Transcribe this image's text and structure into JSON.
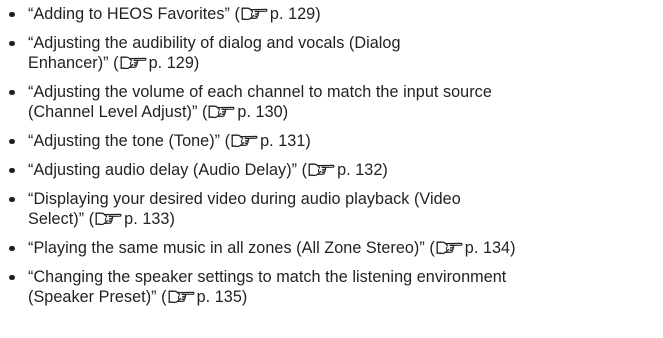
{
  "items": [
    {
      "lines": [
        "“Adding to HEOS Favorites” ("
      ],
      "page": "p. 129",
      "tail": ")"
    },
    {
      "lines": [
        "“Adjusting the audibility of dialog and vocals (Dialog",
        "Enhancer)” ("
      ],
      "page": "p. 129",
      "tail": ")"
    },
    {
      "lines": [
        "“Adjusting the volume of each channel to match the input source",
        "(Channel Level Adjust)” ("
      ],
      "page": "p. 130",
      "tail": ")"
    },
    {
      "lines": [
        "“Adjusting the tone (Tone)” ("
      ],
      "page": "p. 131",
      "tail": ")"
    },
    {
      "lines": [
        "“Adjusting audio delay (Audio Delay)” ("
      ],
      "page": "p. 132",
      "tail": ")"
    },
    {
      "lines": [
        "“Displaying your desired video during audio playback (Video",
        "Select)” ("
      ],
      "page": "p. 133",
      "tail": ")"
    },
    {
      "lines": [
        "“Playing the same music in all zones (All Zone Stereo)” ("
      ],
      "page": "p. 134",
      "tail": ")"
    },
    {
      "lines": [
        "“Changing the speaker settings to match the listening environment",
        "(Speaker Preset)” ("
      ],
      "page": "p. 135",
      "tail": ")"
    }
  ],
  "icons": {
    "reference": "pointing-hand-icon"
  },
  "colors": {
    "text": "#231f20"
  }
}
